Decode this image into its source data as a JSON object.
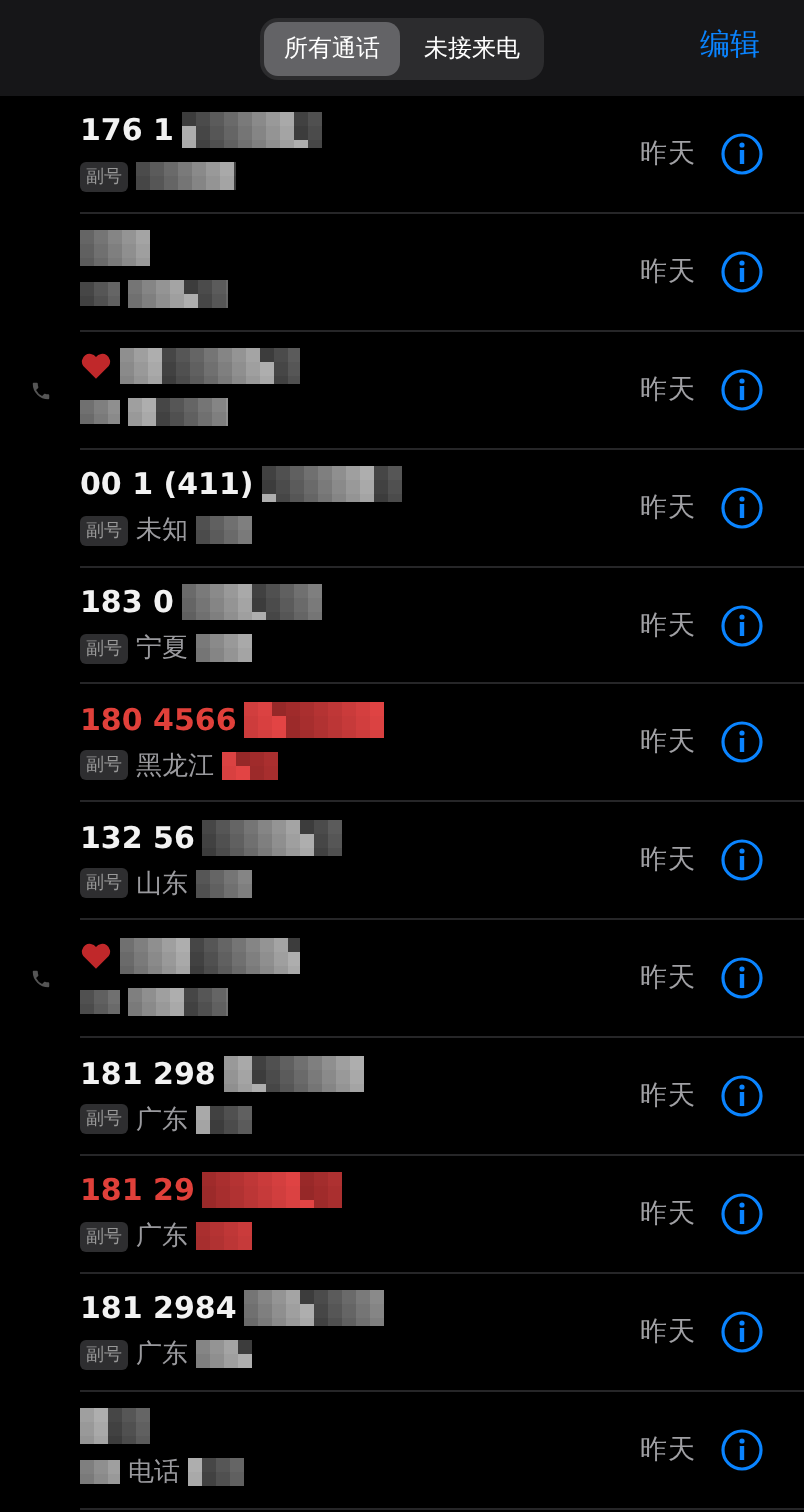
{
  "segments": [
    {
      "label": "所有通话",
      "selected": true
    },
    {
      "label": "未接来电",
      "selected": false
    }
  ],
  "edit": "编辑",
  "calls": [
    {
      "number": "176 1",
      "missed": false,
      "outgoing": false,
      "heart": false,
      "tag": "副号",
      "time": "昨天"
    },
    {
      "missed": false,
      "outgoing": false,
      "heart": false,
      "time": "昨天"
    },
    {
      "missed": false,
      "outgoing": true,
      "heart": true,
      "time": "昨天"
    },
    {
      "number": "00 1 (411)",
      "missed": false,
      "outgoing": false,
      "heart": false,
      "tag": "副号",
      "location": "未知",
      "time": "昨天"
    },
    {
      "number": "183 0",
      "missed": false,
      "outgoing": false,
      "heart": false,
      "tag": "副号",
      "location": "宁夏",
      "time": "昨天"
    },
    {
      "number": "180 4566",
      "missed": true,
      "outgoing": false,
      "heart": false,
      "tag": "副号",
      "location": "黑龙江",
      "time": "昨天"
    },
    {
      "number": "132 56",
      "missed": false,
      "outgoing": false,
      "heart": false,
      "tag": "副号",
      "location": "山东",
      "time": "昨天"
    },
    {
      "missed": false,
      "outgoing": true,
      "heart": true,
      "time": "昨天"
    },
    {
      "number": "181 298",
      "missed": false,
      "outgoing": false,
      "heart": false,
      "tag": "副号",
      "location": "广东",
      "time": "昨天"
    },
    {
      "number": "181 29",
      "missed": true,
      "outgoing": false,
      "heart": false,
      "tag": "副号",
      "location": "广东",
      "time": "昨天"
    },
    {
      "number": "181 2984",
      "missed": false,
      "outgoing": false,
      "heart": false,
      "tag": "副号",
      "location": "广东",
      "time": "昨天"
    },
    {
      "missed": false,
      "outgoing": false,
      "heart": false,
      "location": "电话",
      "time": "昨天"
    }
  ]
}
